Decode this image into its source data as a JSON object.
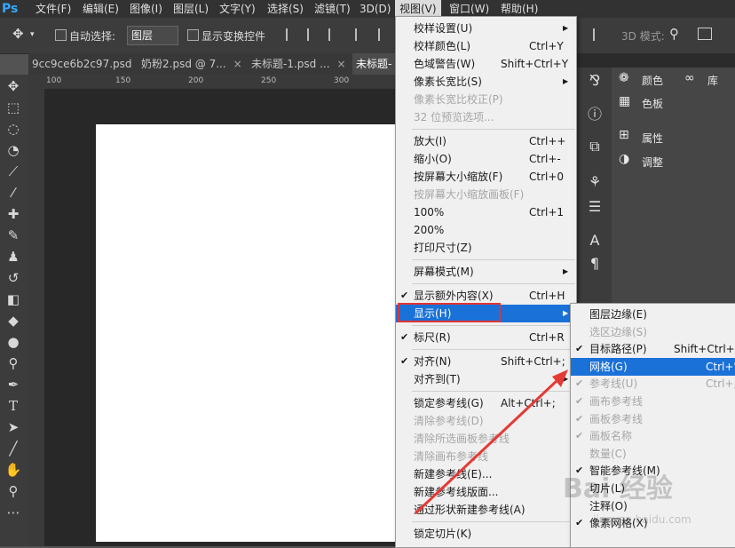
{
  "app": {
    "logo": "Ps"
  },
  "menubar": [
    "文件(F)",
    "编辑(E)",
    "图像(I)",
    "图层(L)",
    "文字(Y)",
    "选择(S)",
    "滤镜(T)",
    "3D(D)",
    "视图(V)",
    "窗口(W)",
    "帮助(H)"
  ],
  "options": {
    "auto_select_label": "自动选择:",
    "auto_select_value": "图层",
    "show_transform_label": "显示变换控件",
    "mode_3d_label": "3D 模式:"
  },
  "tabs": [
    "9cc9ce6b2c97.psd",
    "奶粉2.psd @ 7...",
    "未标题-1.psd ...",
    "未标题-"
  ],
  "ruler": {
    "h_ticks": [
      "100",
      "150",
      "200",
      "250",
      "300"
    ]
  },
  "panels": {
    "color": "颜色",
    "swatches": "色板",
    "properties": "属性",
    "adjustments": "调整",
    "libraries": "库"
  },
  "view_menu": [
    {
      "label": "校样设置(U)",
      "arrow": true
    },
    {
      "label": "校样颜色(L)",
      "shortcut": "Ctrl+Y"
    },
    {
      "label": "色域警告(W)",
      "shortcut": "Shift+Ctrl+Y"
    },
    {
      "label": "像素长宽比(S)",
      "arrow": true
    },
    {
      "label": "像素长宽比校正(P)",
      "disabled": true
    },
    {
      "label": "32 位预览选项...",
      "disabled": true
    },
    {
      "sep": true
    },
    {
      "label": "放大(I)",
      "shortcut": "Ctrl++"
    },
    {
      "label": "缩小(O)",
      "shortcut": "Ctrl+-"
    },
    {
      "label": "按屏幕大小缩放(F)",
      "shortcut": "Ctrl+0"
    },
    {
      "label": "按屏幕大小缩放画板(F)",
      "disabled": true
    },
    {
      "label": "100%",
      "shortcut": "Ctrl+1"
    },
    {
      "label": "200%"
    },
    {
      "label": "打印尺寸(Z)"
    },
    {
      "sep": true
    },
    {
      "label": "屏幕模式(M)",
      "arrow": true
    },
    {
      "sep": true
    },
    {
      "label": "显示额外内容(X)",
      "shortcut": "Ctrl+H",
      "checked": true
    },
    {
      "label": "显示(H)",
      "arrow": true,
      "highlighted": true
    },
    {
      "sep": true
    },
    {
      "label": "标尺(R)",
      "shortcut": "Ctrl+R",
      "checked": true
    },
    {
      "sep": true
    },
    {
      "label": "对齐(N)",
      "shortcut": "Shift+Ctrl+;",
      "checked": true
    },
    {
      "label": "对齐到(T)",
      "arrow": true
    },
    {
      "sep": true
    },
    {
      "label": "锁定参考线(G)",
      "shortcut": "Alt+Ctrl+;"
    },
    {
      "label": "清除参考线(D)",
      "disabled": true
    },
    {
      "label": "清除所选画板参考线",
      "disabled": true
    },
    {
      "label": "清除画布参考线",
      "disabled": true
    },
    {
      "label": "新建参考线(E)..."
    },
    {
      "label": "新建参考线版面..."
    },
    {
      "label": "通过形状新建参考线(A)"
    },
    {
      "sep": true
    },
    {
      "label": "锁定切片(K)"
    }
  ],
  "show_submenu": [
    {
      "label": "图层边缘(E)"
    },
    {
      "label": "选区边缘(S)",
      "disabled": true
    },
    {
      "label": "目标路径(P)",
      "shortcut": "Shift+Ctrl+H",
      "checked": true
    },
    {
      "label": "网格(G)",
      "shortcut": "Ctrl+'",
      "highlighted": true
    },
    {
      "label": "参考线(U)",
      "shortcut": "Ctrl+;",
      "disabled": true,
      "checked": true
    },
    {
      "label": "画布参考线",
      "disabled": true,
      "checked": true
    },
    {
      "label": "画板参考线",
      "disabled": true,
      "checked": true
    },
    {
      "label": "画板名称",
      "disabled": true,
      "checked": true
    },
    {
      "label": "数量(C)",
      "disabled": true
    },
    {
      "label": "智能参考线(M)",
      "checked": true
    },
    {
      "label": "切片(L)"
    },
    {
      "label": "注释(O)"
    },
    {
      "label": "像素网格(X)",
      "checked": true
    }
  ],
  "watermark": {
    "main": "Bai 经验",
    "sub": "jingyan.baidu.com"
  }
}
